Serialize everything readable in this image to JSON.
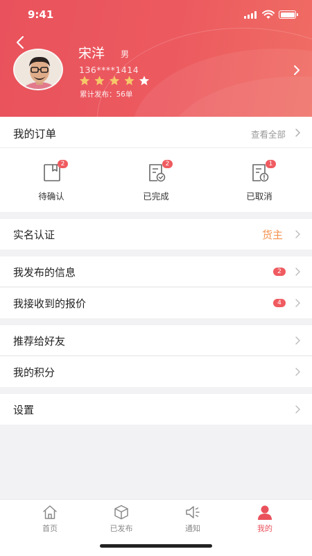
{
  "status_bar": {
    "time": "9:41"
  },
  "profile": {
    "name": "宋洋",
    "gender": "男",
    "phone": "136****1414",
    "rating": 4,
    "rating_max": 5,
    "published_count": "累计发布：56单"
  },
  "orders": {
    "title": "我的订单",
    "view_all": "查看全部",
    "items": [
      {
        "label": "待确认",
        "badge": "2"
      },
      {
        "label": "已完成",
        "badge": "2"
      },
      {
        "label": "已取消",
        "badge": "1"
      }
    ]
  },
  "menu": {
    "verification": {
      "label": "实名认证",
      "tag": "货主"
    },
    "my_posts": {
      "label": "我发布的信息",
      "count": "2"
    },
    "quotes": {
      "label": "我接收到的报价",
      "count": "4"
    },
    "recommend": {
      "label": "推荐给好友"
    },
    "points": {
      "label": "我的积分"
    },
    "settings": {
      "label": "设置"
    }
  },
  "tabbar": {
    "items": [
      {
        "label": "首页",
        "icon": "home-icon"
      },
      {
        "label": "已发布",
        "icon": "box-icon"
      },
      {
        "label": "通知",
        "icon": "speaker-icon"
      },
      {
        "label": "我的",
        "icon": "person-icon",
        "active": true
      }
    ]
  },
  "colors": {
    "accent": "#e9525c",
    "badge": "#ef5b60",
    "tag": "#f4914f",
    "star": "#f5c96a"
  }
}
